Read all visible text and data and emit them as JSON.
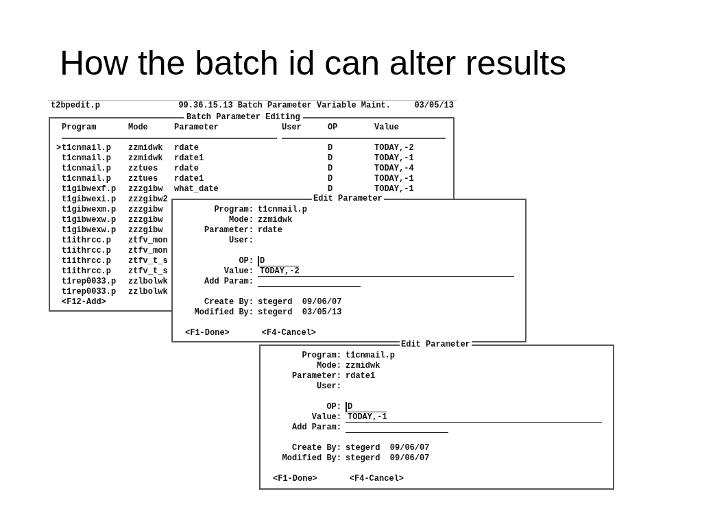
{
  "slide_title": "How the batch id can alter results",
  "main_window": {
    "program": "t2bpedit.p",
    "title": "99.36.15.13 Batch Parameter Variable Maint.",
    "date": "03/05/13",
    "frame_title": "Batch Parameter Editing",
    "columns": [
      "Program",
      "Mode",
      "Parameter",
      "User",
      "OP",
      "Value"
    ],
    "cursor_mark": ">",
    "rows": [
      {
        "selected": true,
        "program": "t1cnmail.p",
        "mode": "zzmidwk",
        "parameter": "rdate",
        "op": "D",
        "value": "TODAY,-2"
      },
      {
        "selected": false,
        "program": "t1cnmail.p",
        "mode": "zzmidwk",
        "parameter": "rdate1",
        "op": "D",
        "value": "TODAY,-1"
      },
      {
        "selected": false,
        "program": "t1cnmail.p",
        "mode": "zztues",
        "parameter": "rdate",
        "op": "D",
        "value": "TODAY,-4"
      },
      {
        "selected": false,
        "program": "t1cnmail.p",
        "mode": "zztues",
        "parameter": "rdate1",
        "op": "D",
        "value": "TODAY,-1"
      },
      {
        "selected": false,
        "program": "t1gibwexf.p",
        "mode": "zzzgibw",
        "parameter": "what_date",
        "op": "D",
        "value": "TODAY,-1"
      },
      {
        "selected": false,
        "program": "t1gibwexi.p",
        "mode": "zzzgibw2"
      },
      {
        "selected": false,
        "program": "t1gibwexm.p",
        "mode": "zzzgibw"
      },
      {
        "selected": false,
        "program": "t1gibwexw.p",
        "mode": "zzzgibw"
      },
      {
        "selected": false,
        "program": "t1gibwexw.p",
        "mode": "zzzgibw"
      },
      {
        "selected": false,
        "program": "t1ithrcc.p",
        "mode": "ztfv_mon"
      },
      {
        "selected": false,
        "program": "t1ithrcc.p",
        "mode": "ztfv_mon"
      },
      {
        "selected": false,
        "program": "t1ithrcc.p",
        "mode": "ztfv_t_s"
      },
      {
        "selected": false,
        "program": "t1ithrcc.p",
        "mode": "ztfv_t_s"
      },
      {
        "selected": false,
        "program": "t1rep0033.p",
        "mode": "zzlbolwk"
      },
      {
        "selected": false,
        "program": "t1rep0033.p",
        "mode": "zzlbolwk"
      }
    ],
    "footer": "<F12-Add>"
  },
  "dialogs": [
    {
      "title": "Edit Parameter",
      "sections": [
        [
          {
            "kind": "text",
            "label": "Program:",
            "value": "t1cnmail.p"
          },
          {
            "kind": "text",
            "label": "Mode:",
            "value": "zzmidwk"
          },
          {
            "kind": "text",
            "label": "Parameter:",
            "value": "rdate"
          },
          {
            "kind": "text",
            "label": "User:"
          }
        ],
        [
          {
            "kind": "short",
            "focused": true,
            "label": "OP:",
            "value": "D"
          },
          {
            "kind": "long",
            "focused": false,
            "label": "Value:",
            "value": "TODAY,-2"
          },
          {
            "kind": "medium",
            "focused": false,
            "label": "Add Param:"
          }
        ],
        [
          {
            "kind": "text",
            "label": "Create By:",
            "value": "stegerd  09/06/07"
          },
          {
            "kind": "text",
            "label": "Modified By:",
            "value": "stegerd  03/05/13"
          }
        ]
      ],
      "buttons": [
        "<F1-Done>",
        "<F4-Cancel>"
      ]
    },
    {
      "title": "Edit Parameter",
      "sections": [
        [
          {
            "kind": "text",
            "label": "Program:",
            "value": "t1cnmail.p"
          },
          {
            "kind": "text",
            "label": "Mode:",
            "value": "zzmidwk"
          },
          {
            "kind": "text",
            "label": "Parameter:",
            "value": "rdate1"
          },
          {
            "kind": "text",
            "label": "User:"
          }
        ],
        [
          {
            "kind": "short",
            "focused": true,
            "label": "OP:",
            "value": "D"
          },
          {
            "kind": "long",
            "focused": false,
            "label": "Value:",
            "value": "TODAY,-1"
          },
          {
            "kind": "medium",
            "focused": false,
            "label": "Add Param:"
          }
        ],
        [
          {
            "kind": "text",
            "label": "Create By:",
            "value": "stegerd  09/06/07"
          },
          {
            "kind": "text",
            "label": "Modified By:",
            "value": "stegerd  09/06/07"
          }
        ]
      ],
      "buttons": [
        "<F1-Done>",
        "<F4-Cancel>"
      ]
    }
  ]
}
